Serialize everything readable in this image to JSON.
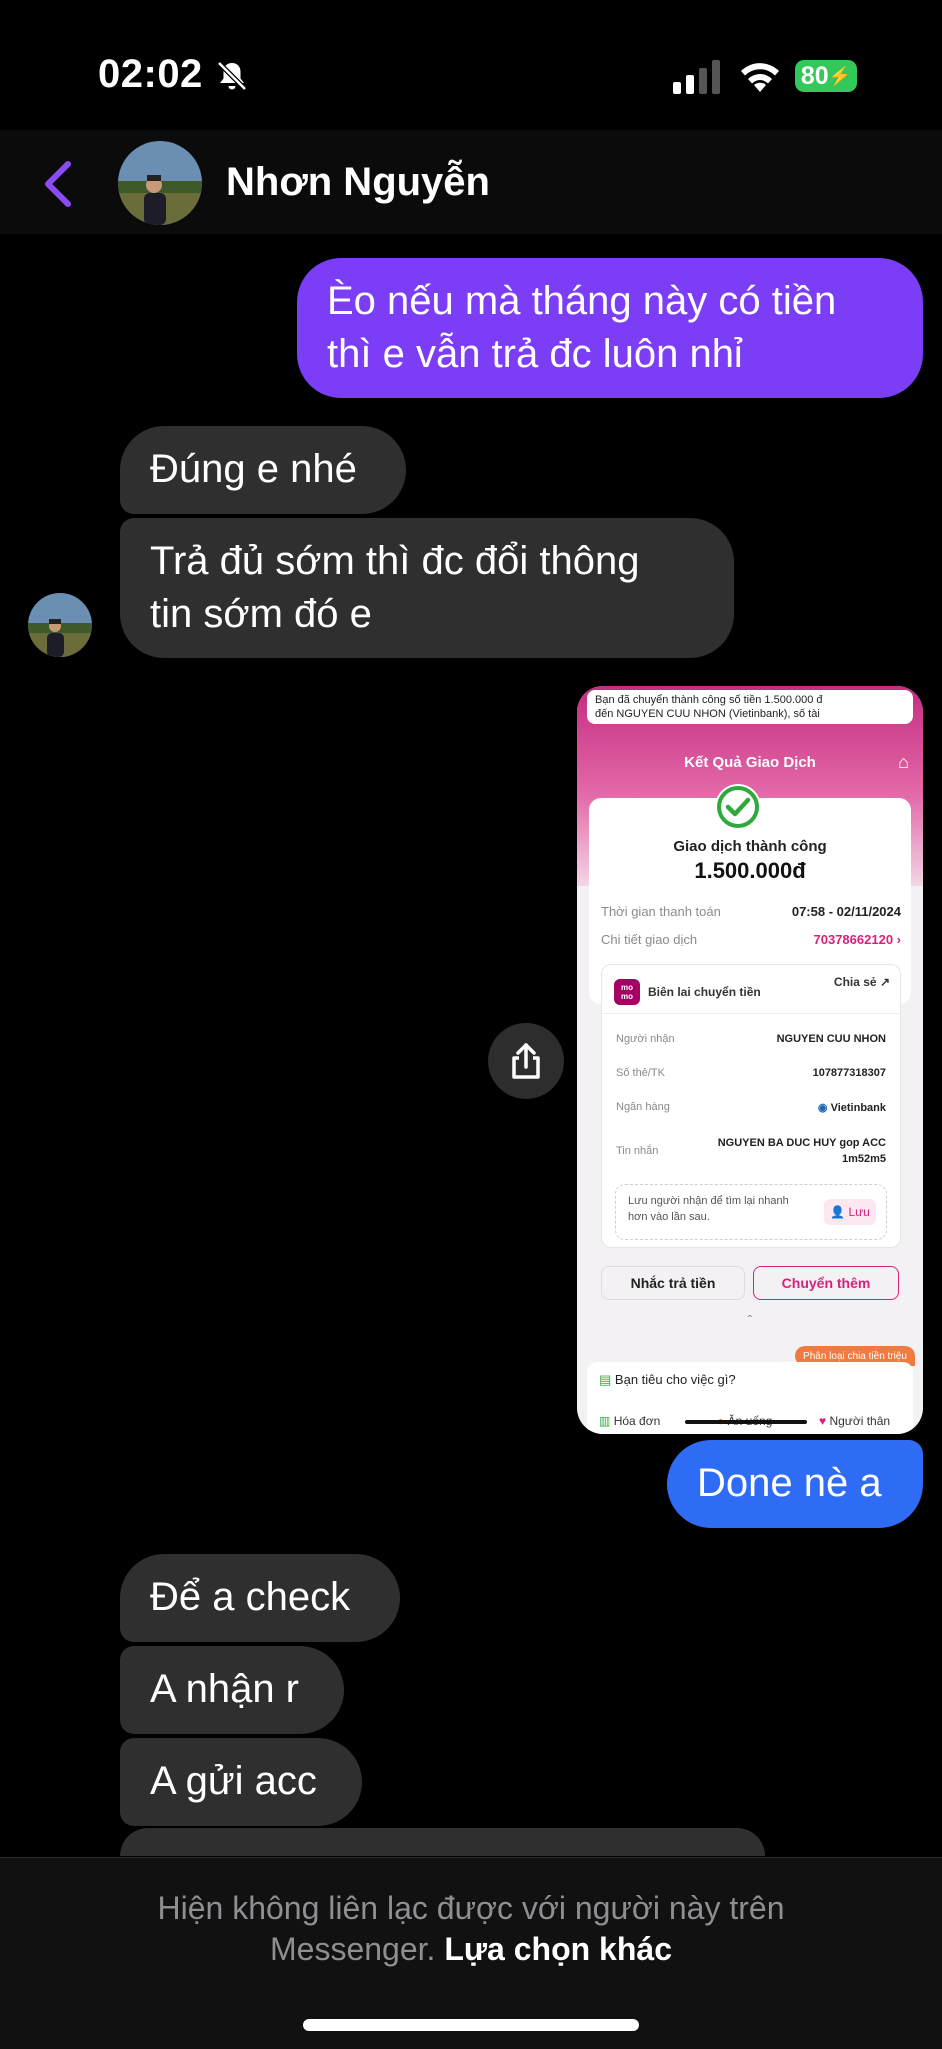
{
  "status_bar": {
    "time": "02:02",
    "battery": "80"
  },
  "header": {
    "contact_name": "Nhơn Nguyễn"
  },
  "messages": [
    {
      "type": "outgoing",
      "text_lines": [
        "Èo nếu mà tháng này có tiền",
        "thì e vẫn trả đc luôn nhỉ"
      ]
    },
    {
      "type": "incoming",
      "text": "Đúng e nhé"
    },
    {
      "type": "incoming",
      "text_lines": [
        "Trả đủ sớm thì đc đổi thông",
        "tin sớm đó e"
      ]
    },
    {
      "type": "outgoing_image"
    },
    {
      "type": "outgoing",
      "text": "Done nè a"
    },
    {
      "type": "incoming",
      "text": "Để a check"
    },
    {
      "type": "incoming",
      "text": "A nhận r"
    },
    {
      "type": "incoming",
      "text": "A gửi acc"
    }
  ],
  "receipt": {
    "banner_line1": "Bạn đã chuyển thành công số tiền 1.500.000 đ",
    "banner_line2": "đến NGUYEN CUU NHON (Vietinbank), số tài",
    "title": "Kết Quả Giao Dịch",
    "status": "Giao dịch thành công",
    "amount": "1.500.000đ",
    "rows": [
      {
        "label": "Thời gian thanh toán",
        "value": "07:58 - 02/11/2024"
      },
      {
        "label": "Chi tiết giao dịch",
        "value": "70378662120 ›"
      }
    ],
    "momo_label": "mo mo",
    "receipt_label": "Biên lai chuyển tiền",
    "share_label": "Chia sẻ",
    "details": [
      {
        "label": "Người nhận",
        "value": "NGUYEN CUU NHON"
      },
      {
        "label": "Số thẻ/TK",
        "value": "107877318307"
      },
      {
        "label": "Ngân hàng",
        "value": "Vietinbank"
      },
      {
        "label": "Tin nhắn",
        "value": "NGUYEN BA DUC HUY gop ACC",
        "value2": "1m52m5"
      }
    ],
    "save_text_line1": "Lưu người nhận để tìm lại nhanh",
    "save_text_line2": "hơn vào lần sau.",
    "save_button": "Lưu",
    "remind_button": "Nhắc trả tiền",
    "more_button": "Chuyển thêm",
    "tag": "Phân loại chia tiền triệu",
    "question": "Bạn tiêu cho việc gì?",
    "categories": [
      "Hóa đơn",
      "Ăn uống",
      "Người thân"
    ]
  },
  "bottom": {
    "notice_line1": "Hiện không liên lạc được với người này trên",
    "notice_line2": "Messenger.",
    "other_option": "Lựa chọn khác"
  },
  "colors": {
    "outgoing": "#7b3df5",
    "outgoing_blue": "#2f6cf5",
    "incoming": "#2f2f2f",
    "accent": "#8b4cf7"
  }
}
